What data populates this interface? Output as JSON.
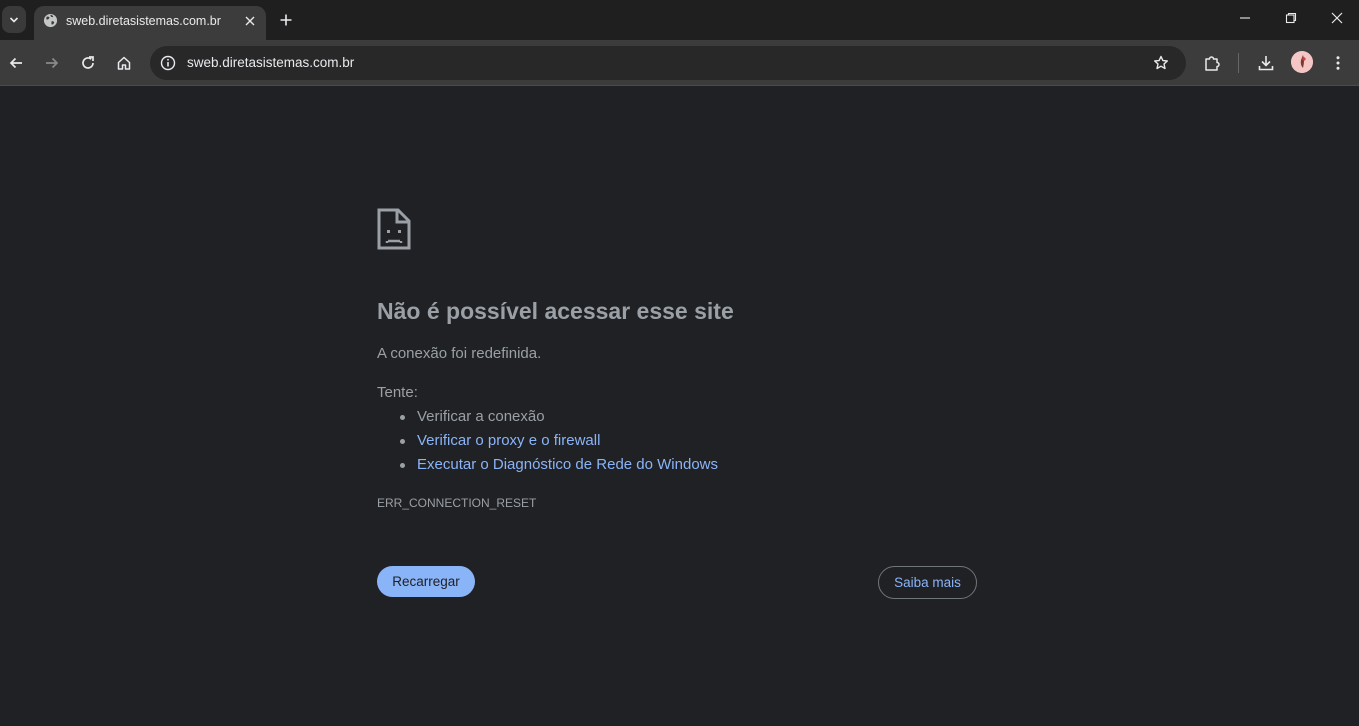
{
  "browser": {
    "tab": {
      "title": "sweb.diretasistemas.com.br",
      "favicon": "globe-icon"
    },
    "omnibox": {
      "url": "sweb.diretasistemas.com.br"
    }
  },
  "error_page": {
    "icon": "sad-document-icon",
    "title": "Não é possível acessar esse site",
    "description": "A conexão foi redefinida.",
    "try_label": "Tente:",
    "suggestions": [
      {
        "text": "Verificar a conexão",
        "is_link": false
      },
      {
        "text": "Verificar o proxy e o firewall",
        "is_link": true
      },
      {
        "text": "Executar o Diagnóstico de Rede do Windows",
        "is_link": true
      }
    ],
    "error_code": "ERR_CONNECTION_RESET",
    "reload_label": "Recarregar",
    "more_label": "Saiba mais"
  },
  "colors": {
    "background": "#202124",
    "text": "#9aa0a6",
    "link": "#8ab4f8",
    "primary_button": "#8ab4f8"
  }
}
